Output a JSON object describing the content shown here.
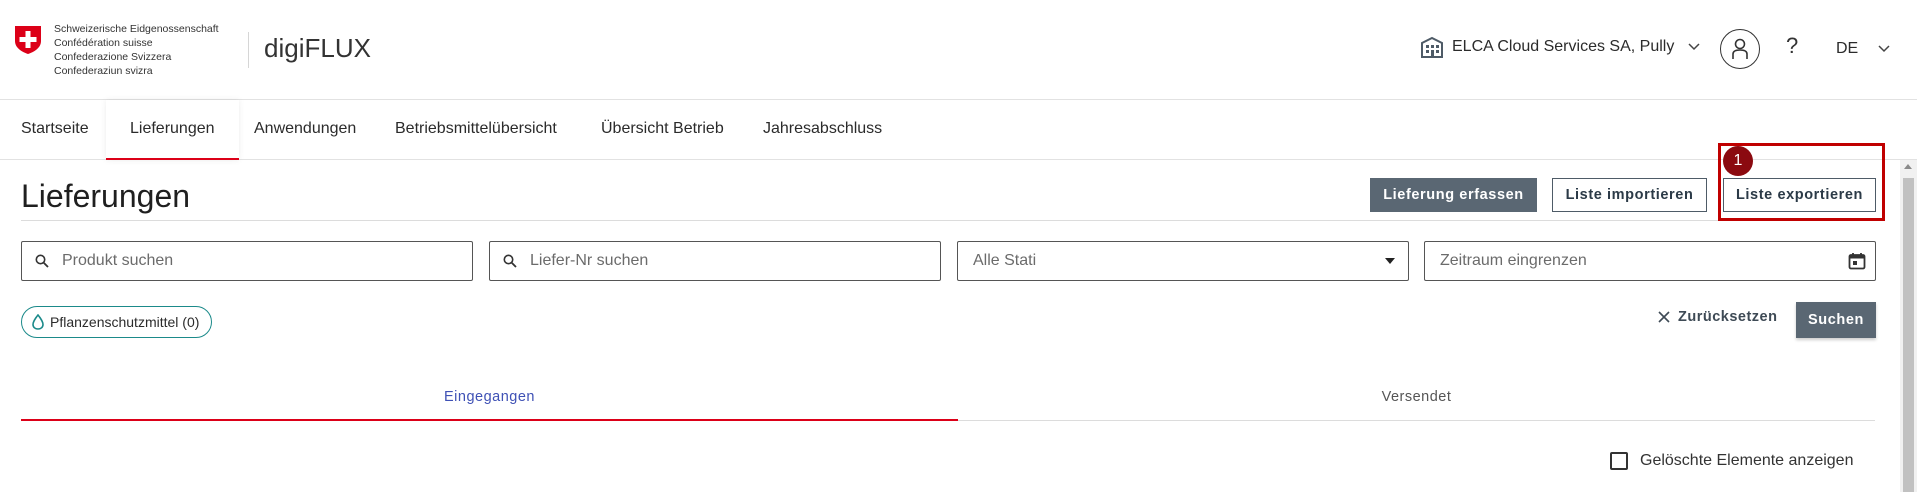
{
  "header": {
    "confederation_lines": [
      "Schweizerische Eidgenossenschaft",
      "Confédération suisse",
      "Confederazione Svizzera",
      "Confederaziun svizra"
    ],
    "app_name": "digiFLUX",
    "organization": "ELCA Cloud Services SA, Pully",
    "help_label": "?",
    "language": "DE"
  },
  "nav": {
    "items": [
      {
        "label": "Startseite"
      },
      {
        "label": "Lieferungen"
      },
      {
        "label": "Anwendungen"
      },
      {
        "label": "Betriebsmittelübersicht"
      },
      {
        "label": "Übersicht Betrieb"
      },
      {
        "label": "Jahresabschluss"
      }
    ],
    "active": "Lieferungen"
  },
  "page": {
    "title": "Lieferungen",
    "actions": {
      "create": "Lieferung erfassen",
      "import": "Liste importieren",
      "export": "Liste exportieren"
    },
    "annotation_badge": "1"
  },
  "filters": {
    "product_placeholder": "Produkt suchen",
    "delivery_no_placeholder": "Liefer-Nr suchen",
    "status_value": "Alle Stati",
    "period_placeholder": "Zeitraum eingrenzen",
    "chip_label": "Pflanzenschutzmittel (0)",
    "reset_label": "Zurücksetzen",
    "search_label": "Suchen"
  },
  "tabs": {
    "incoming": "Eingegangen",
    "sent": "Versendet"
  },
  "options": {
    "show_deleted_label": "Gelöschte Elemente anzeigen"
  },
  "colors": {
    "accent_red": "#dc0018",
    "primary_button": "#5a6773",
    "active_tab_text": "#3f51b5",
    "chip_border": "#1b8a8a",
    "highlight": "#c00000"
  }
}
